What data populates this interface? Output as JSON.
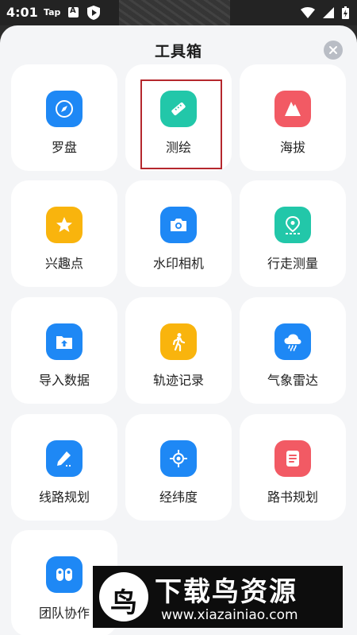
{
  "status_bar": {
    "time": "4:01",
    "app_label": "Tap"
  },
  "sheet": {
    "title": "工具箱"
  },
  "tools": [
    {
      "label": "罗盘",
      "icon": "compass-icon",
      "color": "#1e88f5"
    },
    {
      "label": "测绘",
      "icon": "ruler-icon",
      "color": "#22c7a9"
    },
    {
      "label": "海拔",
      "icon": "mountain-icon",
      "color": "#f25a64"
    },
    {
      "label": "兴趣点",
      "icon": "star-icon",
      "color": "#f9b40d"
    },
    {
      "label": "水印相机",
      "icon": "camera-icon",
      "color": "#1e88f5"
    },
    {
      "label": "行走测量",
      "icon": "location-pin-icon",
      "color": "#22c7a9"
    },
    {
      "label": "导入数据",
      "icon": "upload-folder-icon",
      "color": "#1e88f5"
    },
    {
      "label": "轨迹记录",
      "icon": "walking-person-icon",
      "color": "#f9b40d"
    },
    {
      "label": "气象雷达",
      "icon": "cloud-rain-icon",
      "color": "#1e88f5"
    },
    {
      "label": "线路规划",
      "icon": "pencil-icon",
      "color": "#1e88f5"
    },
    {
      "label": "经纬度",
      "icon": "crosshair-icon",
      "color": "#1e88f5"
    },
    {
      "label": "路书规划",
      "icon": "document-icon",
      "color": "#f25a64"
    },
    {
      "label": "团队协作",
      "icon": "team-icon",
      "color": "#1e88f5"
    }
  ],
  "watermark": {
    "logo_text": "鸟",
    "title": "下载鸟资源",
    "url": "www.xiazainiao.com"
  }
}
